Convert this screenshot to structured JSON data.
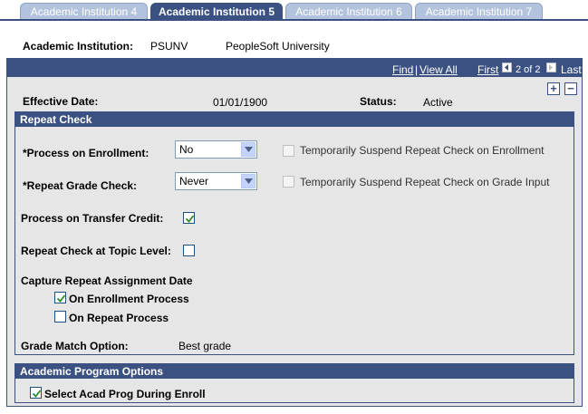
{
  "tabs": [
    {
      "label": "Academic Institution 4",
      "active": false
    },
    {
      "label": "Academic Institution 5",
      "active": true
    },
    {
      "label": "Academic Institution 6",
      "active": false
    },
    {
      "label": "Academic Institution 7",
      "active": false
    }
  ],
  "header": {
    "institution_label": "Academic Institution:",
    "institution_code": "PSUNV",
    "institution_name": "PeopleSoft University"
  },
  "nav": {
    "find": "Find",
    "sep": "|",
    "view_all": "View All",
    "first": "First",
    "page_info": "2 of 2",
    "last": "Last"
  },
  "effective": {
    "date_label": "Effective Date:",
    "date_value": "01/01/1900",
    "status_label": "Status:",
    "status_value": "Active"
  },
  "repeat_check": {
    "title": "Repeat Check",
    "process_enroll_label": "*Process on Enrollment:",
    "process_enroll_value": "No",
    "suspend_enroll_label": "Temporarily Suspend Repeat Check on Enrollment",
    "repeat_grade_label": "*Repeat Grade Check:",
    "repeat_grade_value": "Never",
    "suspend_grade_label": "Temporarily Suspend Repeat Check on Grade Input",
    "transfer_label": "Process on Transfer Credit:",
    "transfer_checked": true,
    "topic_label": "Repeat Check at Topic Level:",
    "topic_checked": false,
    "capture_label": "Capture Repeat Assignment Date",
    "on_enroll_label": "On Enrollment Process",
    "on_enroll_checked": true,
    "on_repeat_label": "On Repeat Process",
    "on_repeat_checked": false,
    "grade_match_label": "Grade Match Option:",
    "grade_match_value": "Best grade"
  },
  "program_options": {
    "title": "Academic Program Options",
    "select_prog_label": "Select Acad Prog During Enroll",
    "select_prog_checked": true
  },
  "colors": {
    "header_blue": "#3a5182",
    "tab_inactive": "#b3c3dd",
    "panel_bg": "#e6e6e6"
  }
}
